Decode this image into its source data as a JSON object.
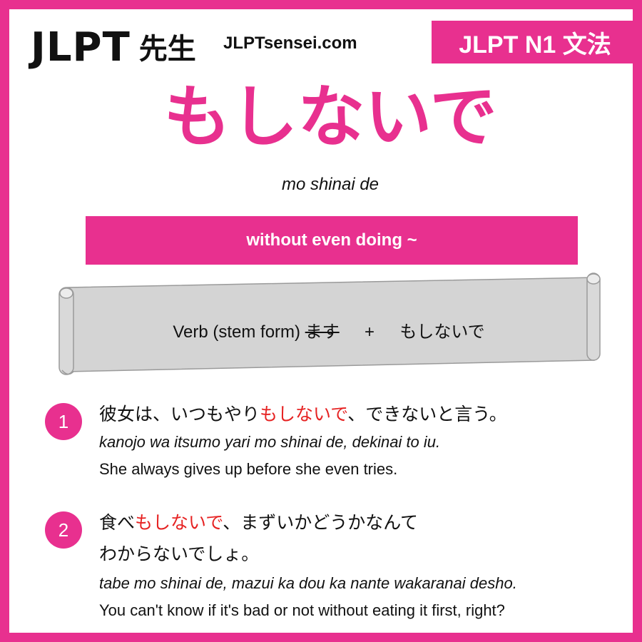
{
  "header": {
    "logo_main": "JLPT",
    "logo_sensei": "先生",
    "site": "JLPTsensei.com",
    "level_badge": "JLPT N1 文法"
  },
  "grammar": {
    "title": "もしないで",
    "romaji": "mo shinai de",
    "meaning": "without even doing ~"
  },
  "formula": {
    "verb": "Verb (stem form)",
    "masu": "ます",
    "plus": "+",
    "pattern": "もしないで"
  },
  "examples": [
    {
      "number": "1",
      "jp_before": "彼女は、いつもやり",
      "jp_highlight": "もしないで",
      "jp_after": "、できないと言う。",
      "romaji": "kanojo wa itsumo yari mo shinai de, dekinai to iu.",
      "english": "She always gives up before she even tries."
    },
    {
      "number": "2",
      "jp_before": "食べ",
      "jp_highlight": "もしないで",
      "jp_after": "、まずいかどうかなんて",
      "jp_line2": "わからないでしょ。",
      "romaji": "tabe mo shinai de, mazui ka dou ka nante wakaranai desho.",
      "english": "You can't know if it's bad or not without eating it first, right?"
    }
  ],
  "colors": {
    "accent": "#e8308f",
    "highlight": "#e62222",
    "scroll_fill": "#d4d4d4"
  }
}
